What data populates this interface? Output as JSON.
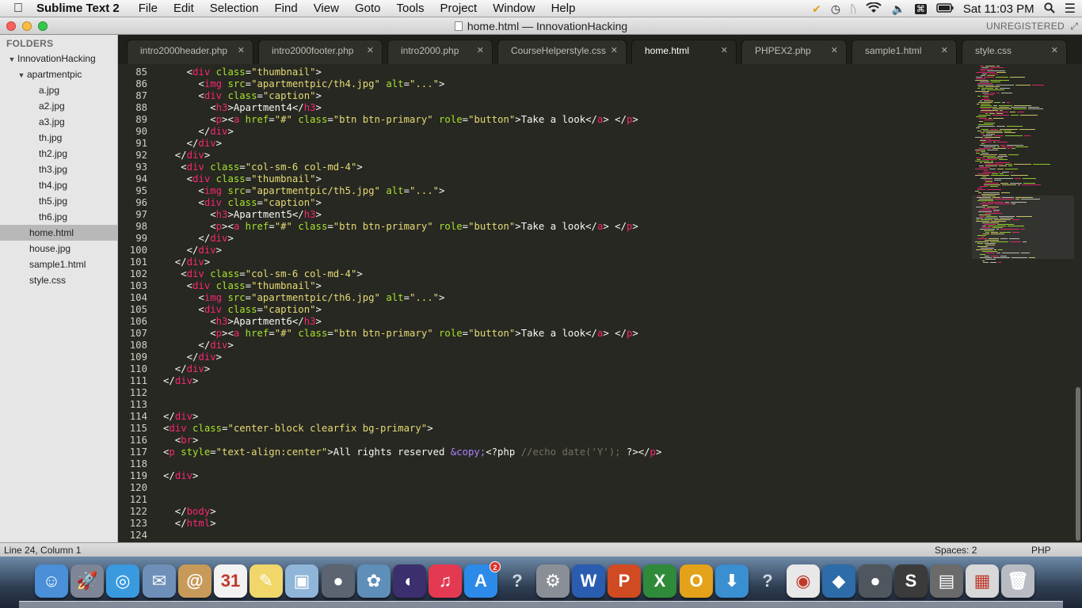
{
  "menubar": {
    "app_name": "Sublime Text 2",
    "items": [
      "File",
      "Edit",
      "Selection",
      "Find",
      "View",
      "Goto",
      "Tools",
      "Project",
      "Window",
      "Help"
    ],
    "clock": "Sat 11:03 PM"
  },
  "window": {
    "title": "home.html — InnovationHacking",
    "unregistered": "UNREGISTERED"
  },
  "sidebar": {
    "header": "FOLDERS",
    "root": "InnovationHacking",
    "subfolder": "apartmentpic",
    "subfolder_files": [
      "a.jpg",
      "a2.jpg",
      "a3.jpg",
      "th.jpg",
      "th2.jpg",
      "th3.jpg",
      "th4.jpg",
      "th5.jpg",
      "th6.jpg"
    ],
    "root_files": [
      "home.html",
      "house.jpg",
      "sample1.html",
      "style.css"
    ],
    "selected": "home.html"
  },
  "tabs": [
    {
      "label": "intro2000header.php"
    },
    {
      "label": "intro2000footer.php"
    },
    {
      "label": "intro2000.php"
    },
    {
      "label": "CourseHelperstyle.css"
    },
    {
      "label": "home.html",
      "active": true
    },
    {
      "label": "PHPEX2.php"
    },
    {
      "label": "sample1.html"
    },
    {
      "label": "style.css"
    }
  ],
  "editor": {
    "lines": [
      {
        "n": "85",
        "text": "    <div class=\"thumbnail\">"
      },
      {
        "n": "86",
        "text": "      <img src=\"apartmentpic/th4.jpg\" alt=\"...\">"
      },
      {
        "n": "87",
        "text": "      <div class=\"caption\">"
      },
      {
        "n": "88",
        "text": "        <h3>Apartment4</h3>"
      },
      {
        "n": "89",
        "text": "        <p><a href=\"#\" class=\"btn btn-primary\" role=\"button\">Take a look</a> </p>"
      },
      {
        "n": "90",
        "text": "      </div>"
      },
      {
        "n": "91",
        "text": "    </div>"
      },
      {
        "n": "92",
        "text": "  </div>"
      },
      {
        "n": "93",
        "text": "   <div class=\"col-sm-6 col-md-4\">"
      },
      {
        "n": "94",
        "text": "    <div class=\"thumbnail\">"
      },
      {
        "n": "95",
        "text": "      <img src=\"apartmentpic/th5.jpg\" alt=\"...\">"
      },
      {
        "n": "96",
        "text": "      <div class=\"caption\">"
      },
      {
        "n": "97",
        "text": "        <h3>Apartment5</h3>"
      },
      {
        "n": "98",
        "text": "        <p><a href=\"#\" class=\"btn btn-primary\" role=\"button\">Take a look</a> </p>"
      },
      {
        "n": "99",
        "text": "      </div>"
      },
      {
        "n": "100",
        "text": "    </div>"
      },
      {
        "n": "101",
        "text": "  </div>"
      },
      {
        "n": "102",
        "text": "   <div class=\"col-sm-6 col-md-4\">"
      },
      {
        "n": "103",
        "text": "    <div class=\"thumbnail\">"
      },
      {
        "n": "104",
        "text": "      <img src=\"apartmentpic/th6.jpg\" alt=\"...\">"
      },
      {
        "n": "105",
        "text": "      <div class=\"caption\">"
      },
      {
        "n": "106",
        "text": "        <h3>Apartment6</h3>"
      },
      {
        "n": "107",
        "text": "        <p><a href=\"#\" class=\"btn btn-primary\" role=\"button\">Take a look</a> </p>"
      },
      {
        "n": "108",
        "text": "      </div>"
      },
      {
        "n": "109",
        "text": "    </div>"
      },
      {
        "n": "110",
        "text": "  </div>"
      },
      {
        "n": "111",
        "text": "</div>"
      },
      {
        "n": "112",
        "text": ""
      },
      {
        "n": "113",
        "text": ""
      },
      {
        "n": "114",
        "text": "</div>"
      },
      {
        "n": "115",
        "text": "<div class=\"center-block clearfix bg-primary\">"
      },
      {
        "n": "116",
        "text": "  <br>"
      },
      {
        "n": "117",
        "text": "<p style=\"text-align:center\">All rights reserved &copy;<?php //echo date('Y'); ?></p>"
      },
      {
        "n": "118",
        "text": ""
      },
      {
        "n": "119",
        "text": "</div>"
      },
      {
        "n": "120",
        "text": ""
      },
      {
        "n": "121",
        "text": ""
      },
      {
        "n": "122",
        "text": "  </body>"
      },
      {
        "n": "123",
        "text": "  </html>"
      },
      {
        "n": "124",
        "text": ""
      }
    ]
  },
  "statusbar": {
    "position": "Line 24, Column 1",
    "indent": "Spaces: 2",
    "syntax": "PHP"
  },
  "dock": {
    "items": [
      {
        "name": "finder",
        "color": "#4a8fd8",
        "glyph": "☺"
      },
      {
        "name": "launchpad",
        "color": "#7d8596",
        "glyph": "🚀"
      },
      {
        "name": "safari",
        "color": "#3a9ae0",
        "glyph": "◎"
      },
      {
        "name": "mail",
        "color": "#6e90b8",
        "glyph": "✉"
      },
      {
        "name": "contacts",
        "color": "#c79a5a",
        "glyph": "@"
      },
      {
        "name": "calendar",
        "color": "#f2f2f2",
        "glyph": "31"
      },
      {
        "name": "notes",
        "color": "#f1d66a",
        "glyph": "✎"
      },
      {
        "name": "preview",
        "color": "#8fb6d8",
        "glyph": "▣"
      },
      {
        "name": "facetime",
        "color": "#5b6470",
        "glyph": "●"
      },
      {
        "name": "iphoto",
        "color": "#5f8fb8",
        "glyph": "✿"
      },
      {
        "name": "eclipse",
        "color": "#3b2f6e",
        "glyph": "◐"
      },
      {
        "name": "itunes",
        "color": "#e33a52",
        "glyph": "♫"
      },
      {
        "name": "app-store",
        "color": "#2c8ae8",
        "glyph": "A",
        "badge": "2"
      },
      {
        "name": "unknown-app",
        "color": "#7a7f88",
        "glyph": "?"
      },
      {
        "name": "system-preferences",
        "color": "#8a8f97",
        "glyph": "⚙"
      },
      {
        "name": "word",
        "color": "#2a5db0",
        "glyph": "W"
      },
      {
        "name": "powerpoint",
        "color": "#d04a22",
        "glyph": "P"
      },
      {
        "name": "excel",
        "color": "#2f8a3a",
        "glyph": "X"
      },
      {
        "name": "outlook",
        "color": "#e3a21a",
        "glyph": "O"
      },
      {
        "name": "downloads",
        "color": "#3a8fd0",
        "glyph": "⬇"
      },
      {
        "name": "unknown-app",
        "color": "#7a7f88",
        "glyph": "?"
      },
      {
        "name": "chrome",
        "color": "#e8e8e8",
        "glyph": "◉"
      },
      {
        "name": "mysql-workbench",
        "color": "#2d6ca8",
        "glyph": "◆"
      },
      {
        "name": "elephant",
        "color": "#50565e",
        "glyph": "●"
      },
      {
        "name": "sublime-text",
        "color": "#3b3b3b",
        "glyph": "S"
      },
      {
        "name": "stack-documents",
        "color": "#6a6a6a",
        "glyph": "▤"
      },
      {
        "name": "stack-downloads",
        "color": "#d8d8d8",
        "glyph": "▦"
      },
      {
        "name": "trash",
        "color": "#b8bcc2",
        "glyph": "🗑"
      }
    ]
  },
  "colors": {
    "editor_bg": "#272822",
    "tag": "#f92672",
    "attribute": "#a6e22e",
    "string": "#e6db74",
    "entity": "#ae81ff",
    "comment": "#75715e",
    "sidebar_bg": "#e6e6e6"
  }
}
